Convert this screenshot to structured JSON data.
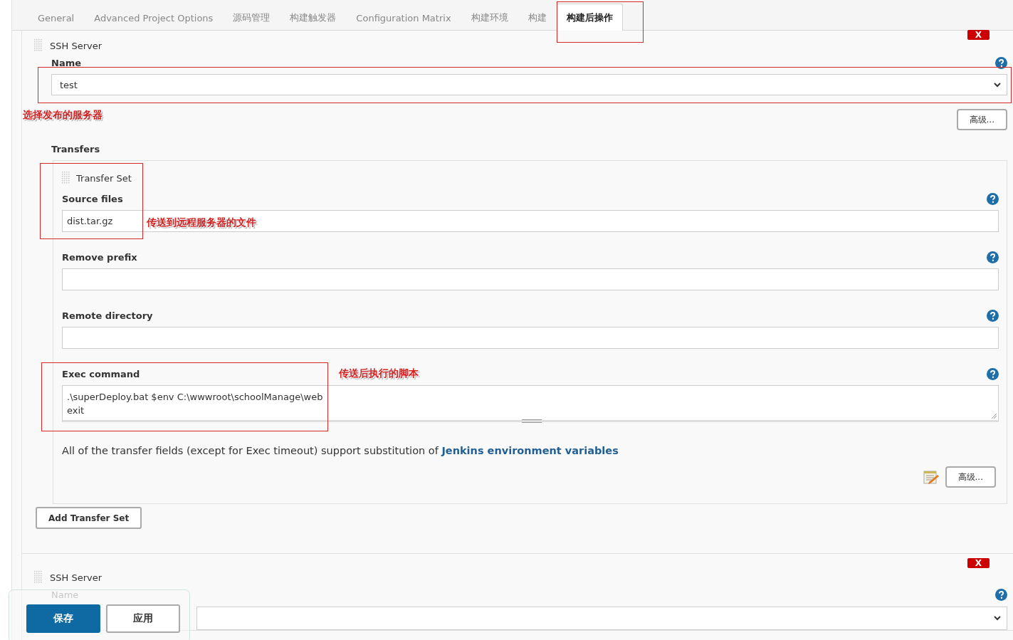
{
  "tabs": [
    {
      "label": "General",
      "selected": false
    },
    {
      "label": "Advanced Project Options",
      "selected": false
    },
    {
      "label": "源码管理",
      "selected": false
    },
    {
      "label": "构建触发器",
      "selected": false
    },
    {
      "label": "Configuration Matrix",
      "selected": false
    },
    {
      "label": "构建环境",
      "selected": false
    },
    {
      "label": "构建",
      "selected": false
    },
    {
      "label": "构建后操作",
      "selected": true
    }
  ],
  "ssh_servers": [
    {
      "title": "SSH Server",
      "delete_label": "X",
      "name_label": "Name",
      "name_value": "test",
      "annotation": "选择发布的服务器",
      "advanced_button": "高级...",
      "transfers_label": "Transfers",
      "transfer_set": {
        "title": "Transfer Set",
        "fields": [
          {
            "kind": "input",
            "label": "Source files",
            "value": "dist.tar.gz",
            "annotation": "传送到远程服务器的文件"
          },
          {
            "kind": "input",
            "label": "Remove prefix"
          },
          {
            "kind": "input",
            "label": "Remote directory"
          },
          {
            "kind": "textarea",
            "label": "Exec command",
            "value": ".\\superDeploy.bat $env C:\\wwwroot\\schoolManage\\web\nexit",
            "annotation": "传送后执行的脚本"
          }
        ],
        "note": "All of the transfer fields (except for Exec timeout) support substitution of ",
        "note_link": "Jenkins environment variables",
        "advanced_button": "高级..."
      },
      "add_button": "Add Transfer Set"
    },
    {
      "title": "SSH Server",
      "delete_label": "X",
      "name_label": "Name"
    }
  ],
  "bottom_bar": {
    "save": "保存",
    "apply": "应用"
  }
}
